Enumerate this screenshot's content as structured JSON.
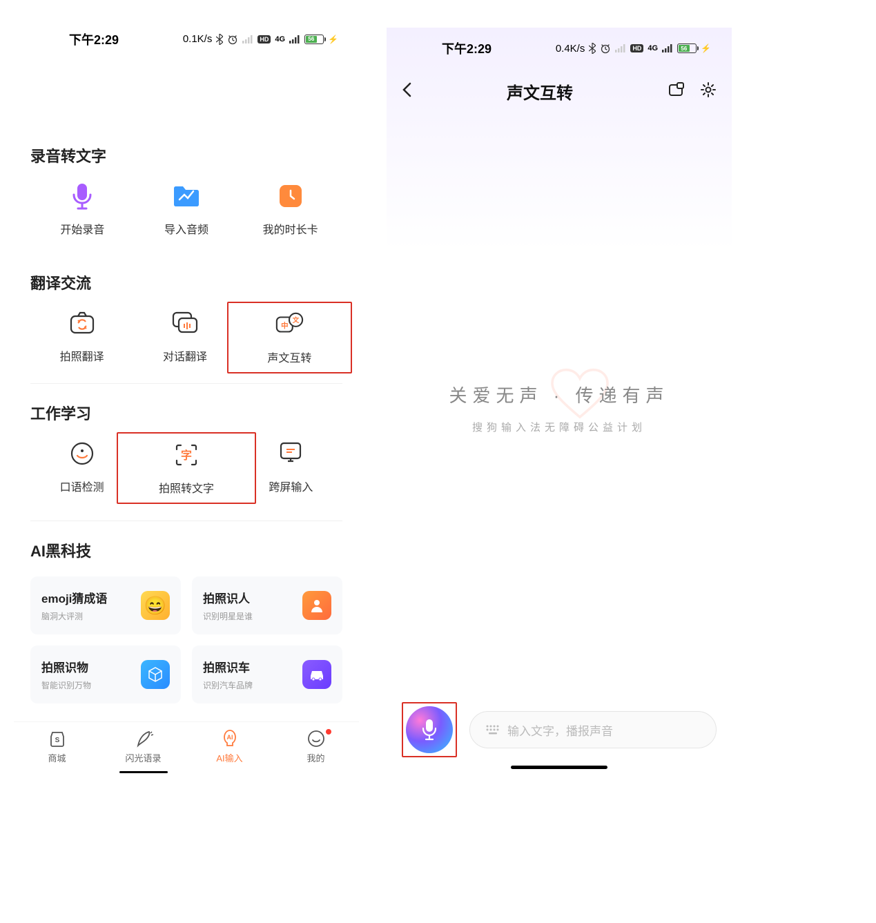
{
  "screen1": {
    "status": {
      "time": "下午2:29",
      "speed": "0.1K/s",
      "battery": "56"
    },
    "sections": {
      "record": {
        "title": "录音转文字",
        "items": [
          "开始录音",
          "导入音频",
          "我的时长卡"
        ]
      },
      "translate": {
        "title": "翻译交流",
        "items": [
          "拍照翻译",
          "对话翻译",
          "声文互转"
        ]
      },
      "work": {
        "title": "工作学习",
        "items": [
          "口语检测",
          "拍照转文字",
          "跨屏输入"
        ]
      },
      "ai": {
        "title": "AI黑科技",
        "cards": [
          {
            "title": "emoji猜成语",
            "sub": "脑洞大评测"
          },
          {
            "title": "拍照识人",
            "sub": "识别明星是谁"
          },
          {
            "title": "拍照识物",
            "sub": "智能识别万物"
          },
          {
            "title": "拍照识车",
            "sub": "识别汽车品牌"
          }
        ]
      }
    },
    "nav": [
      "商城",
      "闪光语录",
      "AI输入",
      "我的"
    ]
  },
  "screen2": {
    "status": {
      "time": "下午2:29",
      "speed": "0.4K/s",
      "battery": "56"
    },
    "header": {
      "title": "声文互转"
    },
    "slogan": {
      "main": "关爱无声 · 传递有声",
      "sub": "搜狗输入法无障碍公益计划"
    },
    "input": {
      "placeholder": "输入文字，播报声音"
    }
  }
}
